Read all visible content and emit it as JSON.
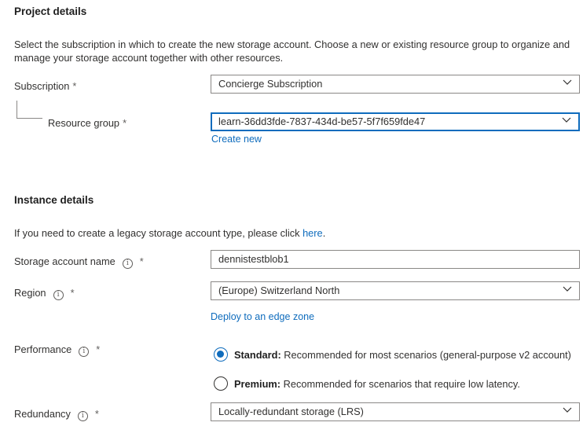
{
  "project": {
    "title": "Project details",
    "description_line1": "Select the subscription in which to create the new storage account. Choose a new or existing resource group to organize and",
    "description_line2": "manage your storage account together with other resources.",
    "subscription": {
      "label": "Subscription",
      "required": "*",
      "value": "Concierge Subscription"
    },
    "resource_group": {
      "label": "Resource group",
      "required": "*",
      "value": "learn-36dd3fde-7837-434d-be57-5f7f659fde47",
      "create_new": "Create new"
    }
  },
  "instance": {
    "title": "Instance details",
    "legacy_text": "If you need to create a legacy storage account type, please click ",
    "legacy_link": "here",
    "legacy_period": ".",
    "storage_name": {
      "label": "Storage account name",
      "required": "*",
      "value": "dennistestblob1"
    },
    "region": {
      "label": "Region",
      "required": "*",
      "value": "(Europe) Switzerland North",
      "edge_zone_link": "Deploy to an edge zone"
    },
    "performance": {
      "label": "Performance",
      "required": "*",
      "options": [
        {
          "title": "Standard:",
          "desc": " Recommended for most scenarios (general-purpose v2 account)",
          "checked": true
        },
        {
          "title": "Premium:",
          "desc": " Recommended for scenarios that require low latency.",
          "checked": false
        }
      ]
    },
    "redundancy": {
      "label": "Redundancy",
      "required": "*",
      "value": "Locally-redundant storage (LRS)"
    }
  },
  "icons": {
    "info": "info-icon",
    "dropdown": "chevron-down-icon"
  },
  "colors": {
    "accent": "#0f6cbd",
    "border": "#8a8886",
    "text": "#323130"
  },
  "info_glyph": "i"
}
